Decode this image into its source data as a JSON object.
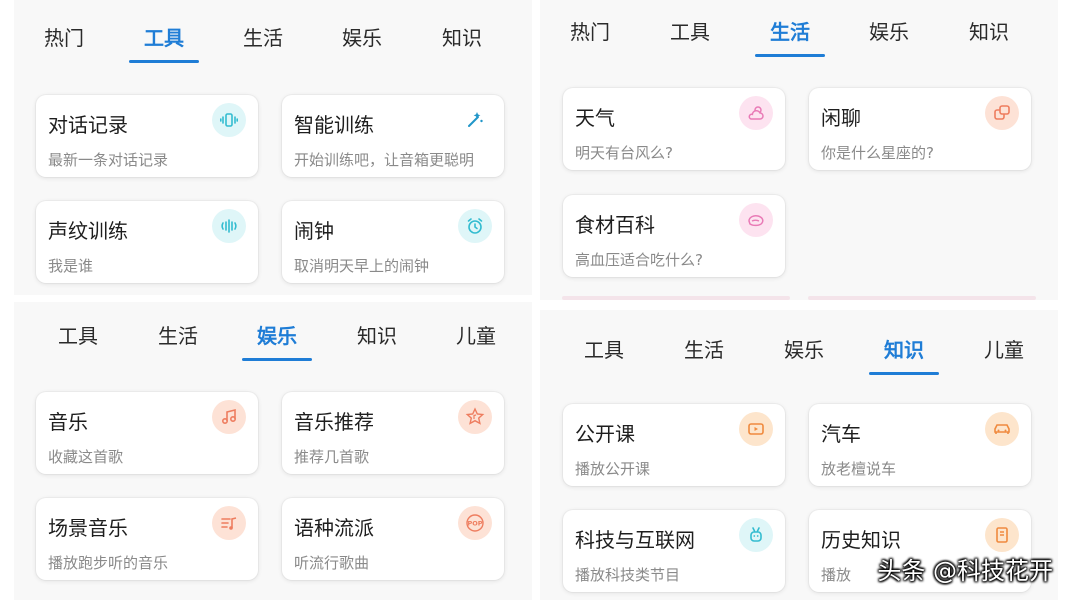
{
  "colors": {
    "accent": "#1f7dd6"
  },
  "panel_tools": {
    "tabs": [
      {
        "label": "热门"
      },
      {
        "label": "工具"
      },
      {
        "label": "生活"
      },
      {
        "label": "娱乐"
      },
      {
        "label": "知识"
      }
    ],
    "active_tab": "工具",
    "cards": [
      {
        "title": "对话记录",
        "sub": "最新一条对话记录",
        "icon": "voice-record-icon"
      },
      {
        "title": "智能训练",
        "sub": "开始训练吧，让音箱更聪明",
        "icon": "magic-wand-icon"
      },
      {
        "title": "声纹训练",
        "sub": "我是谁",
        "icon": "voiceprint-icon"
      },
      {
        "title": "闹钟",
        "sub": "取消明天早上的闹钟",
        "icon": "alarm-clock-icon"
      }
    ]
  },
  "panel_life": {
    "tabs": [
      {
        "label": "热门"
      },
      {
        "label": "工具"
      },
      {
        "label": "生活"
      },
      {
        "label": "娱乐"
      },
      {
        "label": "知识"
      }
    ],
    "active_tab": "生活",
    "cards": [
      {
        "title": "天气",
        "sub": "明天有台风么?",
        "icon": "weather-icon"
      },
      {
        "title": "闲聊",
        "sub": "你是什么星座的?",
        "icon": "chat-icon"
      },
      {
        "title": "食材百科",
        "sub": "高血压适合吃什么?",
        "icon": "food-icon"
      }
    ]
  },
  "panel_entertainment": {
    "tabs": [
      {
        "label": "工具"
      },
      {
        "label": "生活"
      },
      {
        "label": "娱乐"
      },
      {
        "label": "知识"
      },
      {
        "label": "儿童"
      }
    ],
    "active_tab": "娱乐",
    "cards": [
      {
        "title": "音乐",
        "sub": "收藏这首歌",
        "icon": "music-note-icon"
      },
      {
        "title": "音乐推荐",
        "sub": "推荐几首歌",
        "icon": "star-music-icon"
      },
      {
        "title": "场景音乐",
        "sub": "播放跑步听的音乐",
        "icon": "scene-music-icon"
      },
      {
        "title": "语种流派",
        "sub": "听流行歌曲",
        "icon": "pop-genre-icon"
      }
    ]
  },
  "panel_knowledge": {
    "tabs": [
      {
        "label": "工具"
      },
      {
        "label": "生活"
      },
      {
        "label": "娱乐"
      },
      {
        "label": "知识"
      },
      {
        "label": "儿童"
      }
    ],
    "active_tab": "知识",
    "cards": [
      {
        "title": "公开课",
        "sub": "播放公开课",
        "icon": "video-play-icon"
      },
      {
        "title": "汽车",
        "sub": "放老檀说车",
        "icon": "car-icon"
      },
      {
        "title": "科技与互联网",
        "sub": "播放科技类节目",
        "icon": "robot-icon"
      },
      {
        "title": "历史知识",
        "sub": "播放",
        "icon": "book-icon"
      }
    ]
  },
  "icon_badges": {
    "pop_text": "POP"
  },
  "watermark": {
    "text": "头条 @科技花开"
  }
}
